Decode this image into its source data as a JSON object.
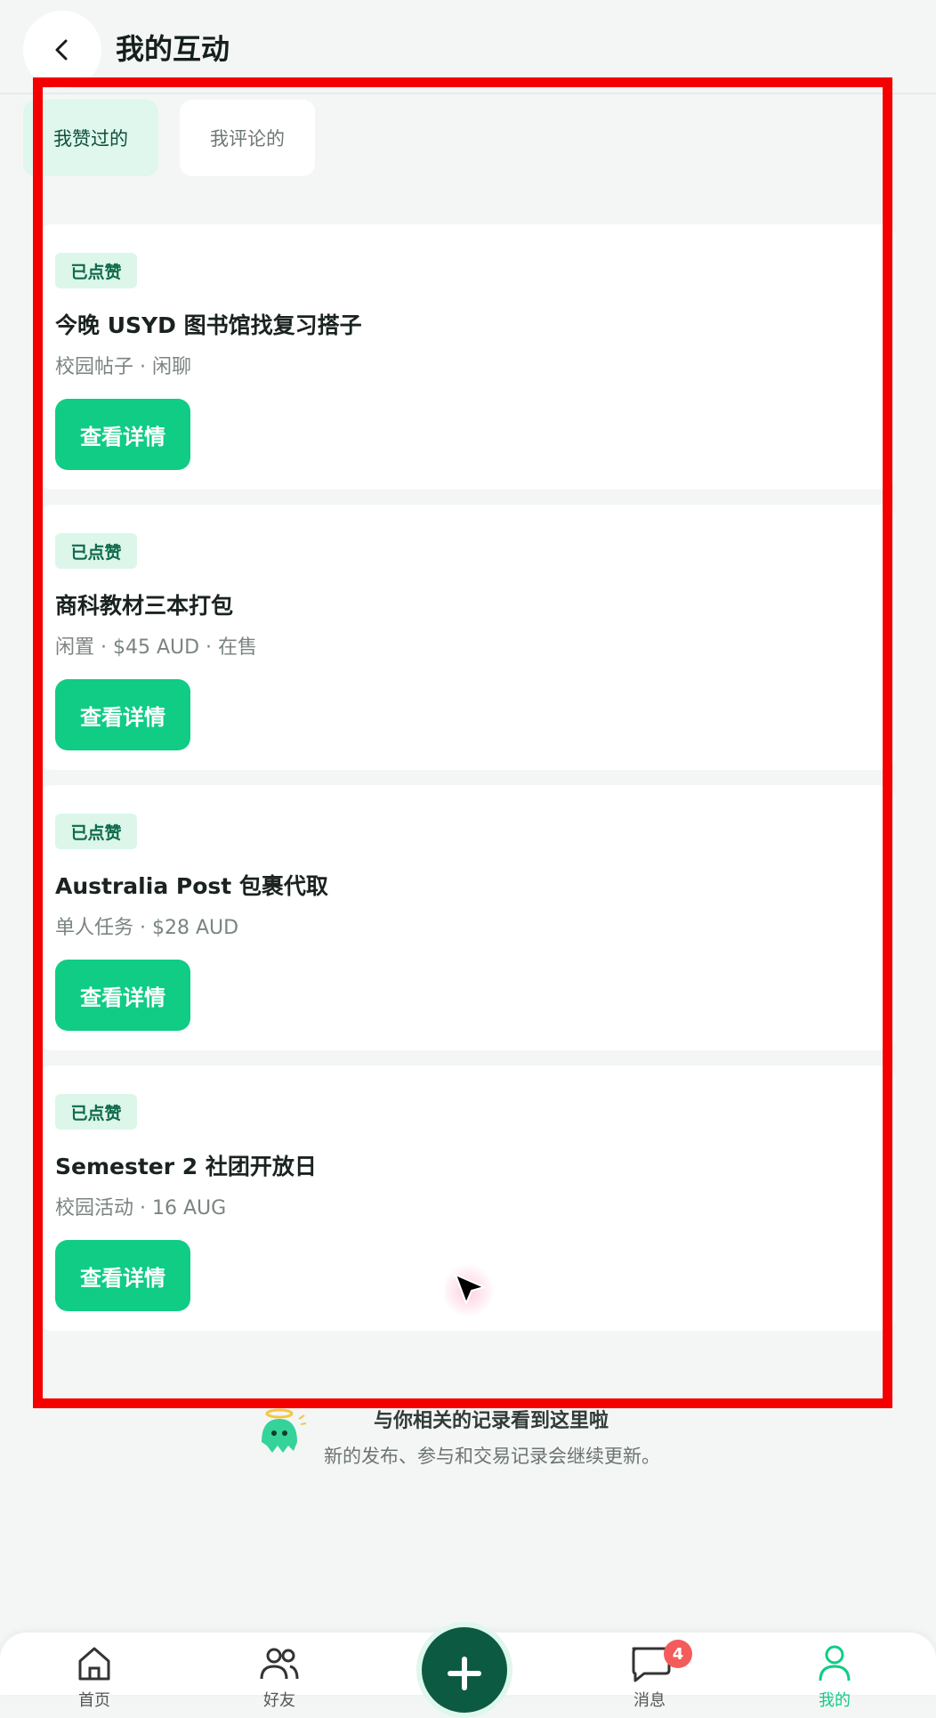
{
  "header": {
    "title": "我的互动",
    "back_icon": "chevron-left-icon"
  },
  "tabs": [
    {
      "label": "我赞过的",
      "active": true
    },
    {
      "label": "我评论的",
      "active": false
    }
  ],
  "cards": [
    {
      "badge": "已点赞",
      "title": "今晚 USYD 图书馆找复习搭子",
      "meta": "校园帖子 · 闲聊",
      "button": "查看详情"
    },
    {
      "badge": "已点赞",
      "title": "商科教材三本打包",
      "meta": "闲置 · $45 AUD · 在售",
      "button": "查看详情"
    },
    {
      "badge": "已点赞",
      "title": "Australia Post 包裹代取",
      "meta": "单人任务 · $28 AUD",
      "button": "查看详情"
    },
    {
      "badge": "已点赞",
      "title": "Semester 2 社团开放日",
      "meta": "校园活动 · 16 AUG",
      "button": "查看详情"
    }
  ],
  "footer": {
    "title": "与你相关的记录看到这里啦",
    "subtitle": "新的发布、参与和交易记录会继续更新。",
    "mascot_icon": "ghost-mascot-icon"
  },
  "bottom_nav": {
    "items": [
      {
        "icon": "home-icon",
        "label": "首页"
      },
      {
        "icon": "people-icon",
        "label": "好友"
      },
      {
        "icon": "plus-icon",
        "label": ""
      },
      {
        "icon": "chat-bubble-icon",
        "label": "消息",
        "badge": "4"
      },
      {
        "icon": "person-icon",
        "label": "我的",
        "active": true
      }
    ]
  },
  "colors": {
    "accent": "#10cc85",
    "accent_dark": "#0d5a43",
    "badge_bg": "#dcf6ea",
    "highlight": "#f40000",
    "notification": "#f45b5b"
  }
}
